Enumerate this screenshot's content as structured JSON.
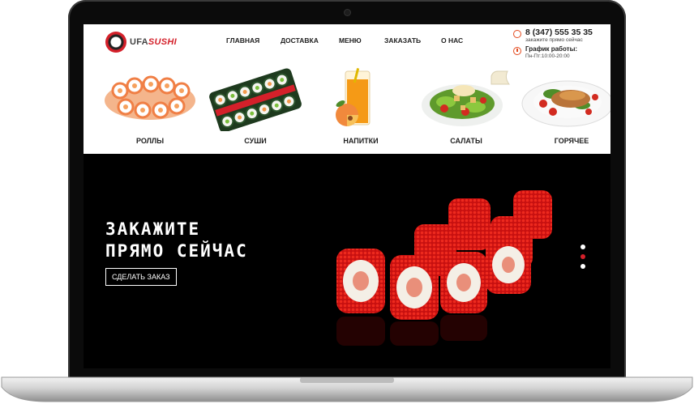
{
  "logo": {
    "part1": "UFA",
    "part2": "SUSHI"
  },
  "nav": [
    {
      "label": "ГЛАВНАЯ"
    },
    {
      "label": "ДОСТАВКА"
    },
    {
      "label": "МЕНЮ"
    },
    {
      "label": "ЗАКАЗАТЬ"
    },
    {
      "label": "О НАС"
    }
  ],
  "contact": {
    "phone": "8 (347) 555 35 35",
    "phone_sub": "закажите прямо сейчас",
    "hours_title": "График работы:",
    "hours": "Пн-Пт:10:00-20:00"
  },
  "categories": [
    {
      "label": "РОЛЛЫ"
    },
    {
      "label": "СУШИ"
    },
    {
      "label": "НАПИТКИ"
    },
    {
      "label": "САЛАТЫ"
    },
    {
      "label": "ГОРЯЧЕЕ"
    }
  ],
  "hero": {
    "title": "ЗАКАЖИТЕ\nПРЯМО СЕЙЧАС",
    "button": "СДЕЛАТЬ ЗАКАЗ",
    "active_slide": 2
  },
  "colors": {
    "accent": "#d4202a",
    "contact_icon": "#e34b1f",
    "hero_bg": "#000000"
  }
}
